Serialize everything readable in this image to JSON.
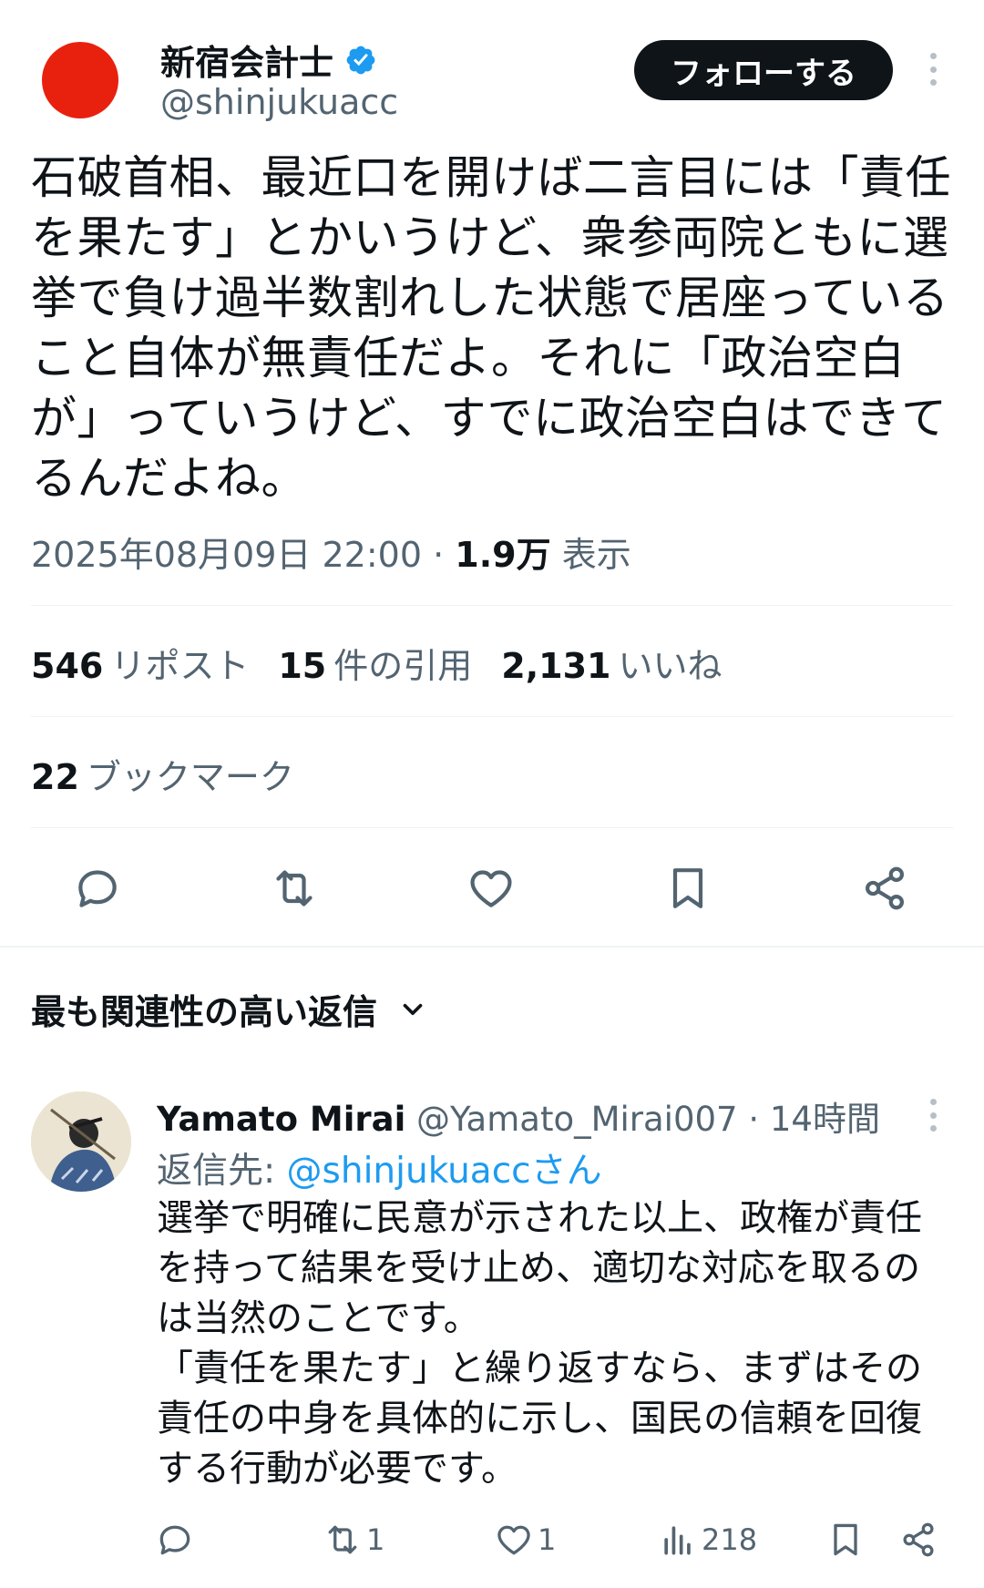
{
  "author": {
    "display_name": "新宿会計士",
    "handle": "@shinjukuacc",
    "verified": true,
    "avatar_color": "#e8210f"
  },
  "follow_button": "フォローする",
  "tweet": {
    "lines": [
      "石破首相、最近口を開けば二言目には「責任",
      "を果たす」とかいうけど、衆参両院ともに選",
      "挙で負け過半数割れした状態で居座っている",
      "こと自体が無責任だよ。それに「政治空白",
      "が」っていうけど、すでに政治空白はできて",
      "るんだよね。"
    ],
    "timestamp": "2025年08月09日 22:00",
    "separator": "·",
    "views_count": "1.9万",
    "views_label": "表示"
  },
  "stats": {
    "reposts_count": "546",
    "reposts_label": "リポスト",
    "quotes_count": "15",
    "quotes_label": "件の引用",
    "likes_count": "2,131",
    "likes_label": "いいね",
    "bookmarks_count": "22",
    "bookmarks_label": "ブックマーク"
  },
  "actions": [
    "reply-icon",
    "repost-icon",
    "like-icon",
    "bookmark-icon",
    "share-icon"
  ],
  "replies_sort": {
    "label": "最も関連性の高い返信"
  },
  "reply": {
    "display_name": "Yamato Mirai",
    "handle": "@Yamato_Mirai007",
    "separator": "·",
    "time": "14時間",
    "reply_to_prefix": "返信先:",
    "reply_to_mention": "@shinjukuaccさん",
    "lines": [
      "選挙で明確に民意が示された以上、政権が責任",
      "を持って結果を受け止め、適切な対応を取るの",
      "は当然のことです。",
      "「責任を果たす」と繰り返すなら、まずはその",
      "責任の中身を具体的に示し、国民の信頼を回復",
      "する行動が必要です。"
    ],
    "reposts": "1",
    "likes": "1",
    "views": "218"
  },
  "colors": {
    "text": "#0f1419",
    "secondary": "#536471",
    "accent": "#1d9bf0",
    "divider": "#eff3f4"
  }
}
